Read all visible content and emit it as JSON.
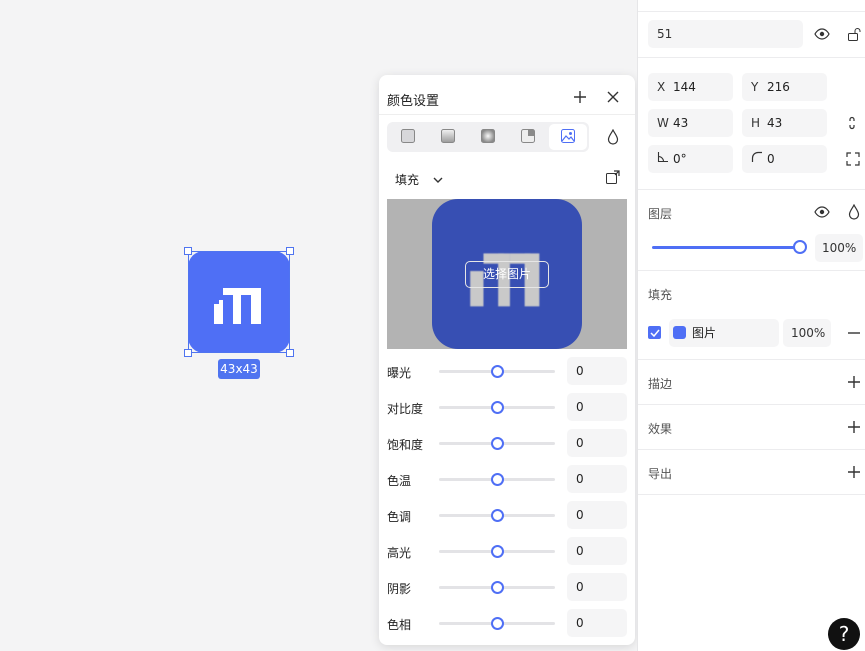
{
  "canvas": {
    "size_badge": "43x43"
  },
  "color_popup": {
    "title": "颜色设置",
    "mode_tabs": [
      "solid-fill",
      "linear-gradient",
      "radial-gradient",
      "angular-gradient",
      "image-fill"
    ],
    "active_tab": "image-fill",
    "fill_mode": "填充",
    "pick_image_label": "选择图片",
    "adjustments": [
      {
        "label": "曝光",
        "value": "0"
      },
      {
        "label": "对比度",
        "value": "0"
      },
      {
        "label": "饱和度",
        "value": "0"
      },
      {
        "label": "色温",
        "value": "0"
      },
      {
        "label": "色调",
        "value": "0"
      },
      {
        "label": "高光",
        "value": "0"
      },
      {
        "label": "阴影",
        "value": "0"
      },
      {
        "label": "色相",
        "value": "0"
      }
    ]
  },
  "panel": {
    "name_value": "51",
    "x_label": "X",
    "x_value": "144",
    "y_label": "Y",
    "y_value": "216",
    "w_label": "W",
    "w_value": "43",
    "h_label": "H",
    "h_value": "43",
    "rotation_value": "0°",
    "radius_value": "0",
    "layer_title": "图层",
    "opacity_value": "100%",
    "opacity_fraction": 1.0,
    "fill_title": "填充",
    "fill_type_label": "图片",
    "fill_opacity": "100%",
    "stroke_title": "描边",
    "effects_title": "效果",
    "export_title": "导出"
  },
  "colors": {
    "accent": "#4f6ff5"
  }
}
